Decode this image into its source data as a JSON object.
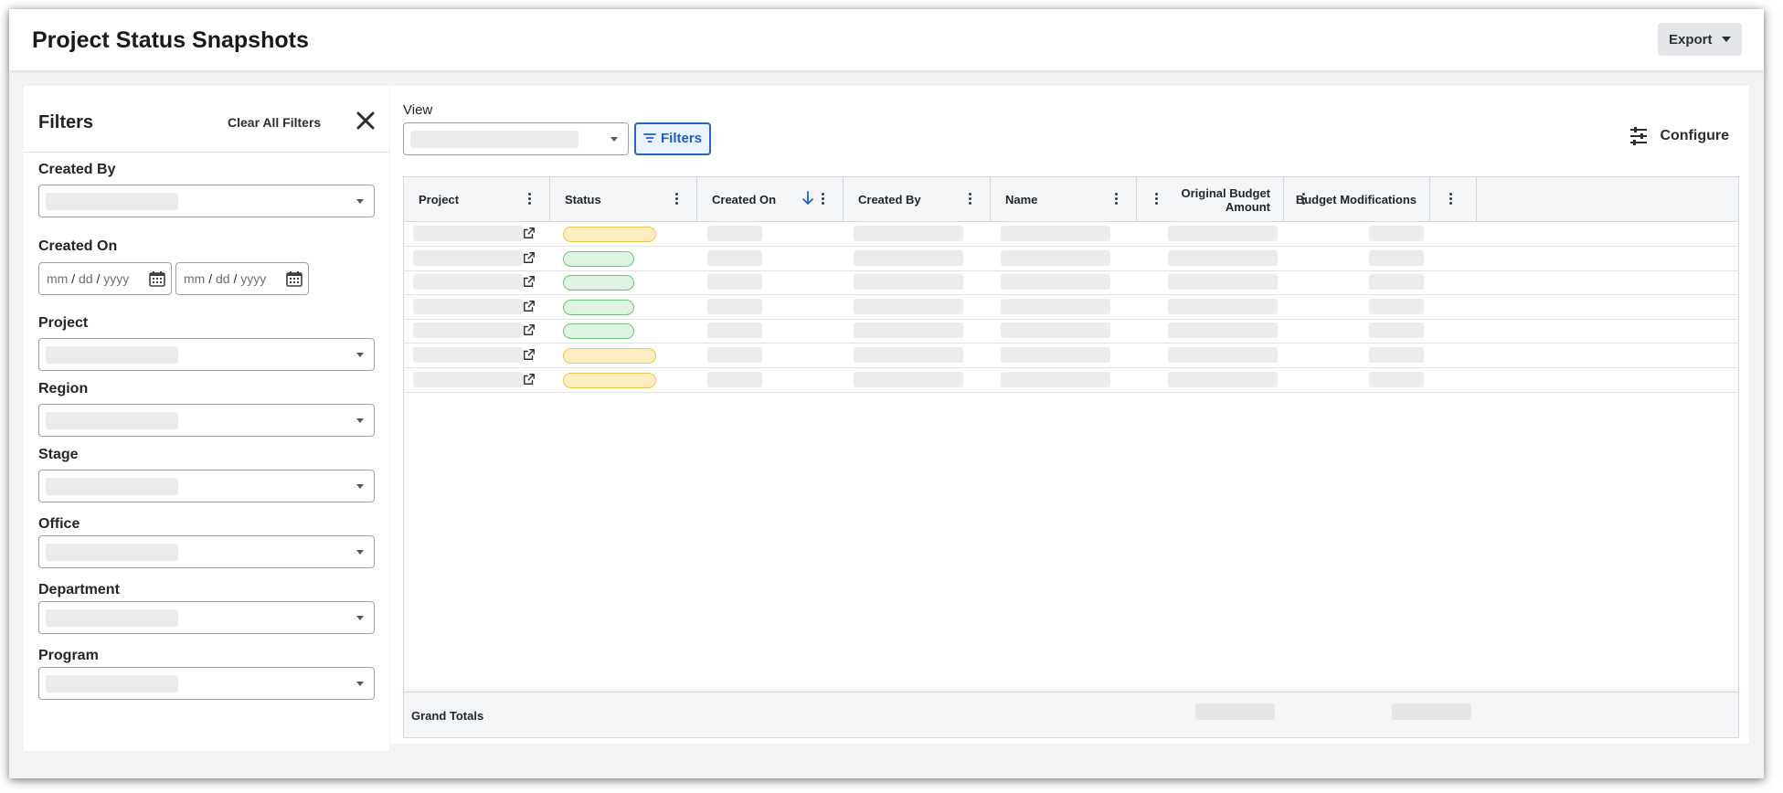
{
  "header": {
    "title": "Project Status Snapshots",
    "export_label": "Export"
  },
  "filters": {
    "title": "Filters",
    "clear_all": "Clear All Filters",
    "fields": {
      "created_by": "Created By",
      "created_on": "Created On",
      "project": "Project",
      "region": "Region",
      "stage": "Stage",
      "office": "Office",
      "department": "Department",
      "program": "Program"
    },
    "date_placeholder": {
      "mm": "mm",
      "dd": "dd",
      "yyyy": "yyyy",
      "sep": "/"
    }
  },
  "toolbar": {
    "view_label": "View",
    "filters_button": "Filters",
    "configure": "Configure"
  },
  "table": {
    "columns": [
      "Project",
      "Status",
      "Created On",
      "Created By",
      "Name",
      "Original Budget Amount",
      "Budget Modifications"
    ],
    "sorted_column": "Created On",
    "sort_direction": "descending",
    "row_statuses": [
      "yellow",
      "green",
      "green",
      "green",
      "green",
      "yellow",
      "yellow"
    ],
    "grand_totals": "Grand Totals"
  },
  "colors": {
    "accent": "#2066c8",
    "status_yellow": "#fdeec2",
    "status_green": "#dff3e2"
  },
  "icons": [
    "close-icon",
    "caret-down-icon",
    "calendar-icon",
    "filter-icon",
    "sliders-icon",
    "kebab-icon",
    "sort-arrow-down-icon",
    "external-link-icon"
  ]
}
